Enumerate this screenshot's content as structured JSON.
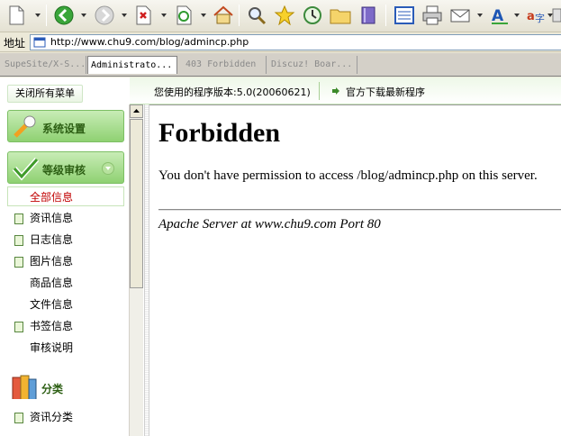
{
  "address_bar": {
    "label": "地址",
    "url": "http://www.chu9.com/blog/admincp.php"
  },
  "tabs": [
    {
      "label": "SupeSite/X-S..."
    },
    {
      "label": "Administrato..."
    },
    {
      "label": "403 Forbidden"
    },
    {
      "label": "Discuz! Boar..."
    }
  ],
  "sidebar": {
    "close_all": "关闭所有菜单",
    "system_settings": "系统设置",
    "level_review": "等级审核",
    "items": [
      {
        "label": "全部信息"
      },
      {
        "label": "资讯信息"
      },
      {
        "label": "日志信息"
      },
      {
        "label": "图片信息"
      },
      {
        "label": "商品信息"
      },
      {
        "label": "文件信息"
      },
      {
        "label": "书签信息"
      },
      {
        "label": "审核说明"
      }
    ],
    "category": "分类",
    "category_items": [
      {
        "label": "资讯分类"
      }
    ]
  },
  "infobar": {
    "version_text": "您使用的程序版本:5.0(20060621)",
    "download_text": "官方下载最新程序"
  },
  "forbidden": {
    "title": "Forbidden",
    "message": "You don't have permission to access /blog/admincp.php on this server.",
    "server": "Apache Server at www.chu9.com Port 80"
  }
}
